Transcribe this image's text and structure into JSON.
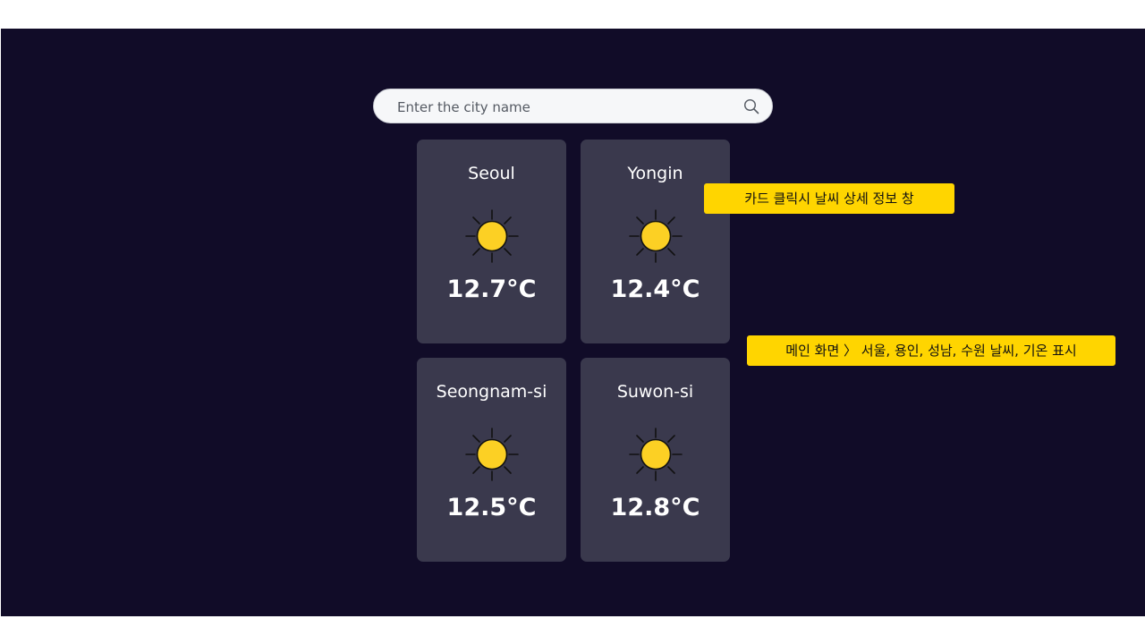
{
  "search": {
    "placeholder": "Enter the city name",
    "icon": "search-icon"
  },
  "cards": [
    {
      "city": "Seoul",
      "temp": "12.7°C",
      "icon": "sun-icon"
    },
    {
      "city": "Yongin",
      "temp": "12.4°C",
      "icon": "sun-icon"
    },
    {
      "city": "Seongnam-si",
      "temp": "12.5°C",
      "icon": "sun-icon"
    },
    {
      "city": "Suwon-si",
      "temp": "12.8°C",
      "icon": "sun-icon"
    }
  ],
  "annotations": {
    "detail": "카드 클릭시 날씨 상세 정보 창",
    "main": "메인 화면 〉 서울, 용인, 성남, 수원 날씨, 기온 표시"
  },
  "colors": {
    "background": "#110c28",
    "card": "#3a394d",
    "sun": "#fcd024",
    "note": "#ffd500"
  }
}
